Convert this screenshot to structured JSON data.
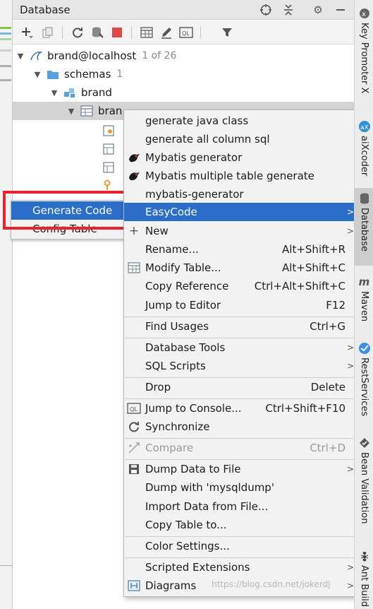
{
  "window": {
    "title": "Database"
  },
  "toolbar": {
    "buttons": [
      "add",
      "duplicate",
      "refresh",
      "schema",
      "stop",
      "table-editor",
      "edit",
      "console",
      "filter"
    ]
  },
  "tree": {
    "root": {
      "label": "brand@localhost",
      "count": "1 of 26"
    },
    "schemas": {
      "label": "schemas",
      "count": "1"
    },
    "schema": {
      "label": "brand"
    },
    "table": {
      "label": "bran"
    }
  },
  "mini_popup": {
    "items": [
      {
        "label": "Generate Code"
      },
      {
        "label": "Config Table"
      }
    ]
  },
  "context_menu": {
    "items": [
      {
        "label": "generate java class"
      },
      {
        "label": "generate all column sql"
      },
      {
        "label": "Mybatis generator"
      },
      {
        "label": "Mybatis multiple table generate"
      },
      {
        "label": "mybatis-generator"
      },
      {
        "label": "EasyCode"
      },
      {
        "label": "New"
      },
      {
        "label": "Rename...",
        "shortcut": "Alt+Shift+R"
      },
      {
        "label": "Modify Table...",
        "shortcut": "Alt+Shift+C"
      },
      {
        "label": "Copy Reference",
        "shortcut": "Ctrl+Alt+Shift+C"
      },
      {
        "label": "Jump to Editor",
        "shortcut": "F12"
      },
      {
        "label": "Find Usages",
        "shortcut": "Ctrl+G"
      },
      {
        "label": "Database Tools"
      },
      {
        "label": "SQL Scripts"
      },
      {
        "label": "Drop",
        "shortcut": "Delete"
      },
      {
        "label": "Jump to Console...",
        "shortcut": "Ctrl+Shift+F10"
      },
      {
        "label": "Synchronize"
      },
      {
        "label": "Compare",
        "shortcut": "Ctrl+D"
      },
      {
        "label": "Dump Data to File"
      },
      {
        "label": "Dump with 'mysqldump'"
      },
      {
        "label": "Import Data from File..."
      },
      {
        "label": "Copy Table to..."
      },
      {
        "label": "Color Settings..."
      },
      {
        "label": "Scripted Extensions"
      },
      {
        "label": "Diagrams"
      }
    ]
  },
  "right_stripe": {
    "tabs": [
      {
        "label": "Key Promoter X"
      },
      {
        "label": "aiXcoder"
      },
      {
        "label": "Database"
      },
      {
        "label": "Maven"
      },
      {
        "label": "RestServices"
      },
      {
        "label": "Bean Validation"
      },
      {
        "label": "Ant Build"
      }
    ]
  },
  "watermark": "https://blog.csdn.net/jokerdj",
  "colors": {
    "accent": "#2b6ec9",
    "highlight_box": "#e8232c",
    "selection_row": "#d4d4d4",
    "menu_bg": "#f2f2f2"
  }
}
